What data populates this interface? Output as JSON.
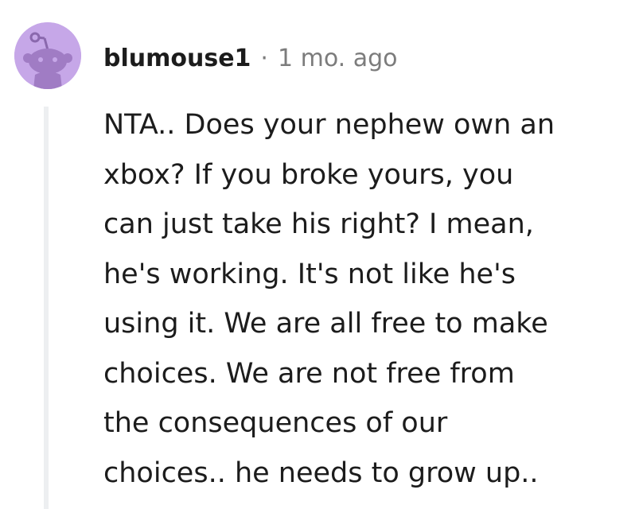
{
  "comment": {
    "username": "blumouse1",
    "separator": "·",
    "timestamp": "1 mo. ago",
    "avatar_icon": "snoo-avatar-icon",
    "avatar_color": "#c6a7e8",
    "body_lines": [
      "NTA.. Does your nephew own an",
      "xbox? If you broke yours, you",
      "can just take his right? I mean,",
      "he's working. It's not like he's",
      "using it. We are all free to make",
      "choices. We are not free from",
      "the consequences of our",
      "choices.. he needs to grow up.."
    ]
  }
}
